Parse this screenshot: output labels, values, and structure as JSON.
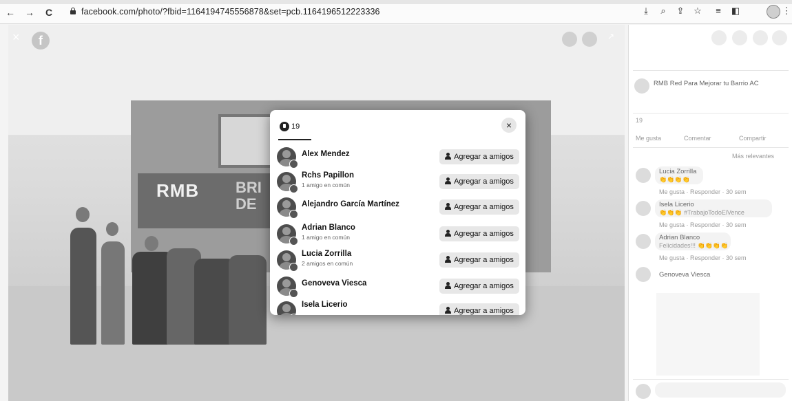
{
  "browser": {
    "url": "facebook.com/photo/?fbid=1164194745556878&set=pcb.1164196512223336",
    "back_icon": "←",
    "forward_icon": "→",
    "reload_icon": "C"
  },
  "photo": {
    "banner_text": "RMB",
    "banner_text2": "BRI",
    "banner_text3": "DE",
    "logo_letter": "f",
    "close_icon": "×",
    "expand_icon": "↗"
  },
  "dialog": {
    "tab_count": "19",
    "close_icon": "×",
    "add_button_label": "Agregar a amigos",
    "people": [
      {
        "name": "Alex Mendez",
        "sub": ""
      },
      {
        "name": "Rchs Papillon",
        "sub": "1 amigo en común"
      },
      {
        "name": "Alejandro García Martínez",
        "sub": ""
      },
      {
        "name": "Adrian Blanco",
        "sub": "1 amigo en común"
      },
      {
        "name": "Lucia Zorrilla",
        "sub": "2 amigos en común"
      },
      {
        "name": "Genoveva Viesca",
        "sub": ""
      },
      {
        "name": "Isela Licerio",
        "sub": ""
      }
    ]
  },
  "right_panel": {
    "post_author": "RMB Red Para Mejorar tu Barrio AC",
    "reactions_count": "19",
    "actions": [
      "Me gusta",
      "Comentar",
      "Compartir"
    ],
    "sort_label": "Más relevantes",
    "comments": [
      {
        "author": "Lucia Zorrilla",
        "text": "👏👏👏👏",
        "meta": "Me gusta · Responder · 30 sem"
      },
      {
        "author": "Isela Licerio",
        "text": "👏👏👏 #TrabajoTodoElVence",
        "meta": "Me gusta · Responder · 30 sem"
      },
      {
        "author": "Adrian Blanco",
        "text": "Felicidades!!! 👏👏👏👏",
        "meta": "Me gusta · Responder · 30 sem"
      },
      {
        "author": "Genoveva Viesca",
        "text": "",
        "meta": ""
      }
    ]
  }
}
